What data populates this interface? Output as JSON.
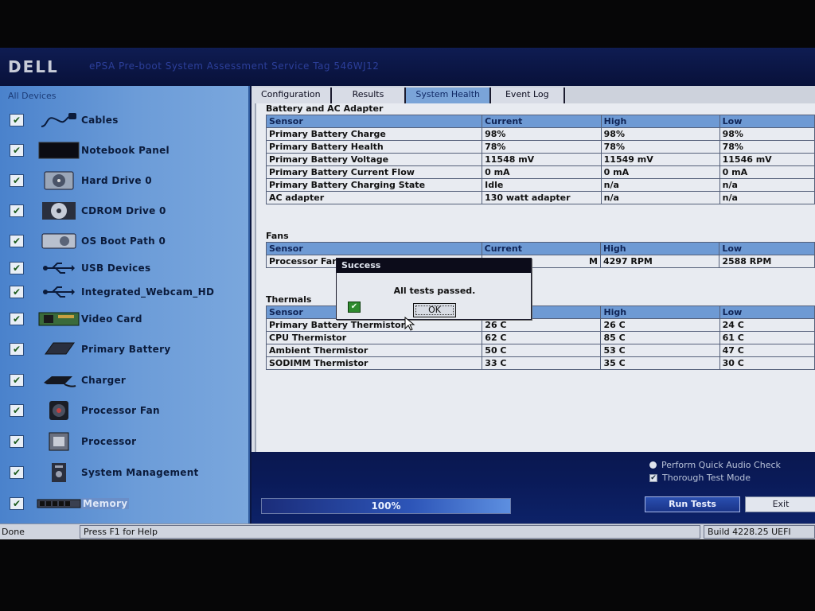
{
  "app": {
    "logo": "DELL",
    "title": "ePSA Pre-boot System Assessment   Service Tag 546WJ12"
  },
  "sidebar": {
    "header": "All Devices",
    "items": [
      {
        "label": "Cables",
        "icon": "cable-icon"
      },
      {
        "label": "Notebook Panel",
        "icon": "monitor-icon"
      },
      {
        "label": "Hard Drive 0",
        "icon": "hard-drive-icon"
      },
      {
        "label": "CDROM Drive 0",
        "icon": "cdrom-icon"
      },
      {
        "label": "OS Boot Path 0",
        "icon": "boot-path-icon"
      },
      {
        "label": "USB Devices",
        "icon": "usb-icon"
      },
      {
        "label": "Integrated_Webcam_HD",
        "icon": "usb-icon"
      },
      {
        "label": "Video Card",
        "icon": "video-card-icon"
      },
      {
        "label": "Primary Battery",
        "icon": "battery-icon"
      },
      {
        "label": "Charger",
        "icon": "charger-icon"
      },
      {
        "label": "Processor Fan",
        "icon": "fan-icon"
      },
      {
        "label": "Processor",
        "icon": "processor-icon"
      },
      {
        "label": "System Management",
        "icon": "system-management-icon"
      },
      {
        "label": "Memory",
        "icon": "memory-icon"
      }
    ]
  },
  "tabs": [
    {
      "label": "Configuration"
    },
    {
      "label": "Results"
    },
    {
      "label": "System Health"
    },
    {
      "label": "Event Log"
    }
  ],
  "battery": {
    "title": "Battery and AC Adapter",
    "headers": [
      "Sensor",
      "Current",
      "High",
      "Low"
    ],
    "rows": [
      [
        "Primary Battery Charge",
        "98%",
        "98%",
        "98%"
      ],
      [
        "Primary Battery Health",
        "78%",
        "78%",
        "78%"
      ],
      [
        "Primary Battery Voltage",
        "11548 mV",
        "11549 mV",
        "11546 mV"
      ],
      [
        "Primary Battery Current Flow",
        "0 mA",
        "0 mA",
        "0 mA"
      ],
      [
        "Primary Battery Charging State",
        "Idle",
        "n/a",
        "n/a"
      ],
      [
        "AC adapter",
        "130 watt adapter",
        "n/a",
        "n/a"
      ]
    ]
  },
  "fans": {
    "title": "Fans",
    "headers": [
      "Sensor",
      "Current",
      "High",
      "Low"
    ],
    "rows": [
      [
        "Processor Fan",
        "M",
        "4297 RPM",
        "2588 RPM"
      ]
    ]
  },
  "thermals": {
    "title": "Thermals",
    "headers": [
      "Sensor",
      "",
      "High",
      "Low"
    ],
    "rows": [
      [
        "Primary Battery Thermistor",
        "26 C",
        "26 C",
        "24 C"
      ],
      [
        "CPU Thermistor",
        "62 C",
        "85 C",
        "61 C"
      ],
      [
        "Ambient Thermistor",
        "50 C",
        "53 C",
        "47 C"
      ],
      [
        "SODIMM Thermistor",
        "33 C",
        "35 C",
        "30 C"
      ]
    ]
  },
  "dialog": {
    "title": "Success",
    "message": "All tests passed.",
    "ok_label": "OK"
  },
  "options": {
    "quick_audio": "Perform Quick Audio Check",
    "thorough": "Thorough Test Mode",
    "thorough_checked": true
  },
  "progress": {
    "percent": 100,
    "label": "100%"
  },
  "buttons": {
    "run": "Run Tests",
    "exit": "Exit"
  },
  "status": {
    "left": "Done",
    "help": "Press F1 for Help",
    "build": "Build  4228.25 UEFI"
  },
  "colors": {
    "accent": "#2a4fb0",
    "table_header": "#6e9ad4",
    "sidebar": "#6c9cd8"
  }
}
